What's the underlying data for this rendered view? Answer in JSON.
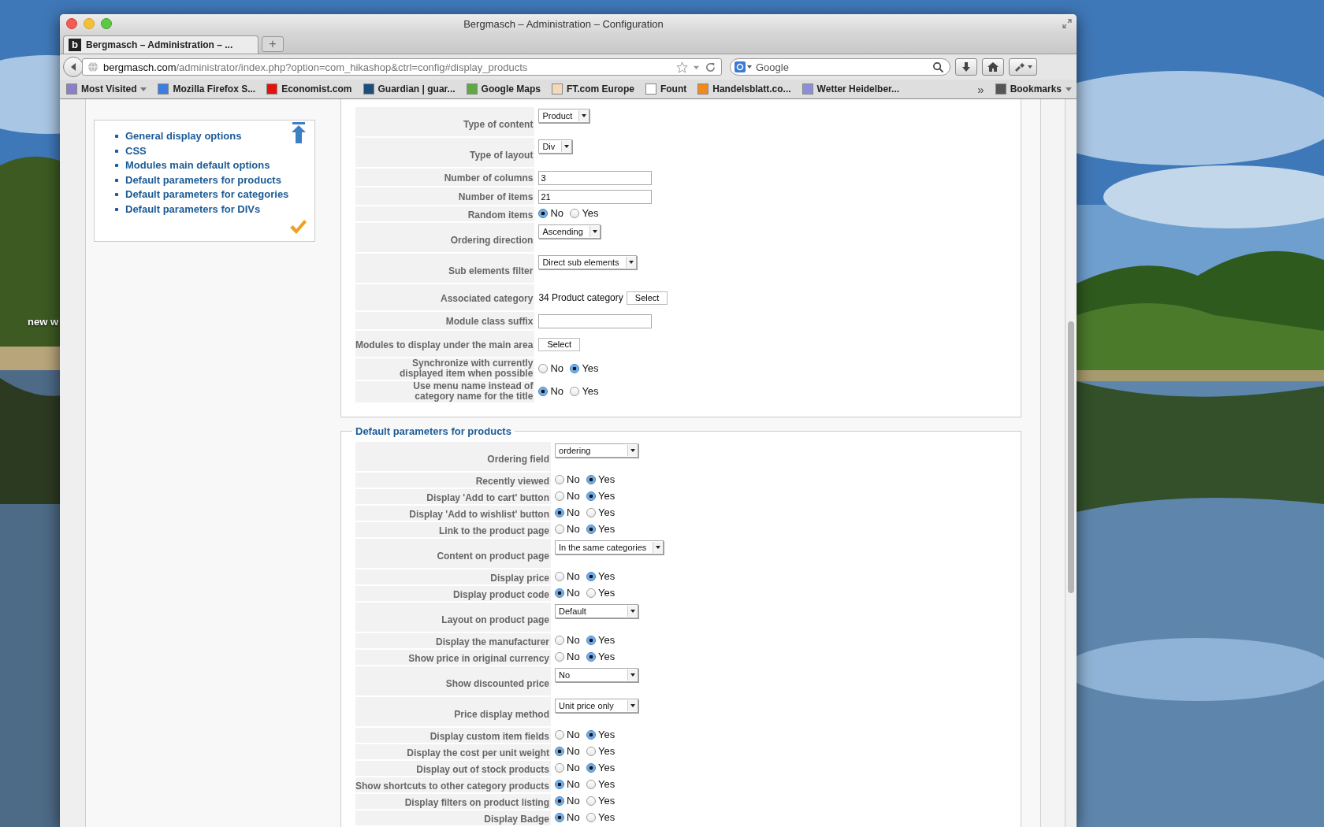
{
  "desktop": {
    "label": "new w"
  },
  "window": {
    "title": "Bergmasch – Administration – Configuration"
  },
  "tabs": [
    {
      "label": "Bergmasch – Administration – ...",
      "favicon": "b",
      "selected": true
    }
  ],
  "new_tab": "+",
  "url": {
    "host": "bergmasch.com",
    "path": "/administrator/index.php?option=com_hikashop&ctrl=config#display_products"
  },
  "search": {
    "placeholder": "Google"
  },
  "bookmarks": [
    {
      "label": "Most Visited",
      "color": "#8a7fc8",
      "menu": true
    },
    {
      "label": "Mozilla Firefox S...",
      "color": "#3d7ce0",
      "menu": false
    },
    {
      "label": "Economist.com",
      "color": "#e3120b",
      "menu": false
    },
    {
      "label": "Guardian | guar...",
      "color": "#1f4d7a",
      "menu": false
    },
    {
      "label": "Google Maps",
      "color": "#5fa844",
      "menu": false
    },
    {
      "label": "FT.com Europe",
      "color": "#f3d9b8",
      "menu": false
    },
    {
      "label": "Fount",
      "color": "#ffffff",
      "menu": false
    },
    {
      "label": "Handelsblatt.co...",
      "color": "#f08a1c",
      "menu": false
    },
    {
      "label": "Wetter Heidelber...",
      "color": "#8c8fd8",
      "menu": false
    }
  ],
  "bookmarks_more": "»",
  "bookmarks_menu": {
    "label": "Bookmarks"
  },
  "sidebar": {
    "items": [
      {
        "label": "General display options"
      },
      {
        "label": "CSS"
      },
      {
        "label": "Modules main default options"
      },
      {
        "label": "Default parameters for products"
      },
      {
        "label": "Default parameters for categories"
      },
      {
        "label": "Default parameters for DIVs"
      }
    ]
  },
  "sections": [
    {
      "rows": [
        {
          "kind": "select",
          "label": "Type of content",
          "value": "Product"
        },
        {
          "kind": "select",
          "label": "Type of layout",
          "value": "Div"
        },
        {
          "kind": "text",
          "label": "Number of columns",
          "value": "3"
        },
        {
          "kind": "text",
          "label": "Number of items",
          "value": "21"
        },
        {
          "kind": "radio",
          "label": "Random items",
          "options": [
            {
              "label": "No",
              "selected": true
            },
            {
              "label": "Yes",
              "selected": false
            }
          ]
        },
        {
          "kind": "select",
          "label": "Ordering direction",
          "value": "Ascending"
        },
        {
          "kind": "select",
          "label": "Sub elements filter",
          "value": "Direct sub elements"
        },
        {
          "kind": "category",
          "label": "Associated category",
          "value": "34 Product category",
          "button": "Select"
        },
        {
          "kind": "text",
          "label": "Module class suffix"
        },
        {
          "kind": "button",
          "label": "Modules to display under the main area",
          "button": "Select"
        },
        {
          "kind": "radio",
          "label": "Synchronize with currently displayed item when possible",
          "options": [
            {
              "label": "No",
              "selected": false
            },
            {
              "label": "Yes",
              "selected": true
            }
          ]
        },
        {
          "kind": "radio",
          "label": "Use menu name instead of category name for the title",
          "options": [
            {
              "label": "No",
              "selected": true
            },
            {
              "label": "Yes",
              "selected": false
            }
          ]
        }
      ]
    },
    {
      "title": "Default parameters for products",
      "rows": [
        {
          "kind": "select",
          "label": "Ordering field",
          "value": "ordering"
        },
        {
          "kind": "radio",
          "label": "Recently viewed",
          "options": [
            {
              "label": "No",
              "selected": false
            },
            {
              "label": "Yes",
              "selected": true
            }
          ]
        },
        {
          "kind": "radio",
          "label": "Display 'Add to cart' button",
          "options": [
            {
              "label": "No",
              "selected": false
            },
            {
              "label": "Yes",
              "selected": true
            }
          ]
        },
        {
          "kind": "radio",
          "label": "Display 'Add to wishlist' button",
          "options": [
            {
              "label": "No",
              "selected": true
            },
            {
              "label": "Yes",
              "selected": false
            }
          ]
        },
        {
          "kind": "radio",
          "label": "Link to the product page",
          "options": [
            {
              "label": "No",
              "selected": false
            },
            {
              "label": "Yes",
              "selected": true
            }
          ]
        },
        {
          "kind": "select",
          "label": "Content on product page",
          "value": "In the same categories"
        },
        {
          "kind": "radio",
          "label": "Display price",
          "options": [
            {
              "label": "No",
              "selected": false
            },
            {
              "label": "Yes",
              "selected": true
            }
          ]
        },
        {
          "kind": "radio",
          "label": "Display product code",
          "options": [
            {
              "label": "No",
              "selected": true
            },
            {
              "label": "Yes",
              "selected": false
            }
          ]
        },
        {
          "kind": "select",
          "label": "Layout on product page",
          "value": "Default"
        },
        {
          "kind": "radio",
          "label": "Display the manufacturer",
          "options": [
            {
              "label": "No",
              "selected": false
            },
            {
              "label": "Yes",
              "selected": true
            }
          ]
        },
        {
          "kind": "radio",
          "label": "Show price in original currency",
          "options": [
            {
              "label": "No",
              "selected": false
            },
            {
              "label": "Yes",
              "selected": true
            }
          ]
        },
        {
          "kind": "select",
          "label": "Show discounted price",
          "value": "No"
        },
        {
          "kind": "select",
          "label": "Price display method",
          "value": "Unit price only"
        },
        {
          "kind": "radio",
          "label": "Display custom item fields",
          "options": [
            {
              "label": "No",
              "selected": false
            },
            {
              "label": "Yes",
              "selected": true
            }
          ]
        },
        {
          "kind": "radio",
          "label": "Display the cost per unit weight",
          "options": [
            {
              "label": "No",
              "selected": true
            },
            {
              "label": "Yes",
              "selected": false
            }
          ]
        },
        {
          "kind": "radio",
          "label": "Display out of stock products",
          "options": [
            {
              "label": "No",
              "selected": false
            },
            {
              "label": "Yes",
              "selected": true
            }
          ]
        },
        {
          "kind": "radio",
          "label": "Show shortcuts to other category products",
          "options": [
            {
              "label": "No",
              "selected": true
            },
            {
              "label": "Yes",
              "selected": false
            }
          ]
        },
        {
          "kind": "radio",
          "label": "Display filters on product listing",
          "options": [
            {
              "label": "No",
              "selected": true
            },
            {
              "label": "Yes",
              "selected": false
            }
          ]
        },
        {
          "kind": "radio",
          "label": "Display Badge",
          "options": [
            {
              "label": "No",
              "selected": true
            },
            {
              "label": "Yes",
              "selected": false
            }
          ]
        }
      ]
    }
  ]
}
